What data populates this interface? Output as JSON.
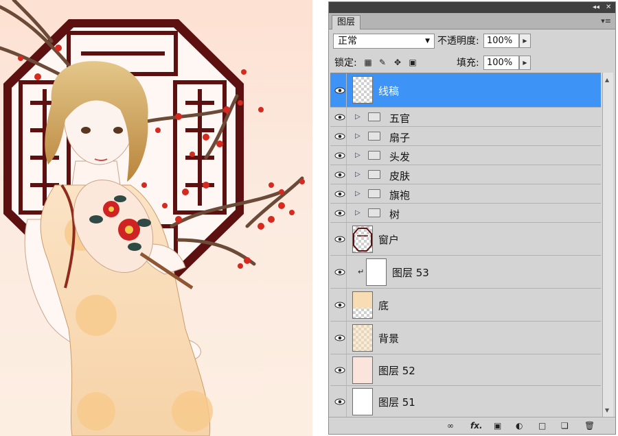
{
  "panel": {
    "tab_title": "图层",
    "collapse_icon": "double-chevron-icon",
    "close_icon": "close-icon",
    "blend_mode": "正常",
    "opacity_label": "不透明度:",
    "opacity_value": "100%",
    "lock_label": "锁定:",
    "fill_label": "填充:",
    "fill_value": "100%"
  },
  "layers": [
    {
      "name": "线稿",
      "type": "layer",
      "selected": true,
      "thumb": "checker"
    },
    {
      "name": "五官",
      "type": "group"
    },
    {
      "name": "扇子",
      "type": "group"
    },
    {
      "name": "头发",
      "type": "group"
    },
    {
      "name": "皮肤",
      "type": "group"
    },
    {
      "name": "旗袍",
      "type": "group"
    },
    {
      "name": "树",
      "type": "group"
    },
    {
      "name": "窗户",
      "type": "layer",
      "thumb": "window"
    },
    {
      "name": "图层 53",
      "type": "clipped",
      "thumb": "white"
    },
    {
      "name": "底",
      "type": "layer",
      "thumb": "checker-peach"
    },
    {
      "name": "背景",
      "type": "layer",
      "thumb": "checker-peach"
    },
    {
      "name": "图层 52",
      "type": "layer",
      "thumb": "pink"
    },
    {
      "name": "图层 51",
      "type": "layer",
      "thumb": "white"
    }
  ],
  "bottom_icons": [
    "link-layers-icon",
    "fx-icon",
    "add-mask-icon",
    "adjustment-layer-icon",
    "new-group-icon",
    "new-layer-icon",
    "delete-layer-icon"
  ],
  "colors": {
    "selection": "#3d94f6",
    "panel_bg": "#d4d4d4",
    "window_frame": "#5c1010",
    "blossom": "#d42a1f"
  }
}
